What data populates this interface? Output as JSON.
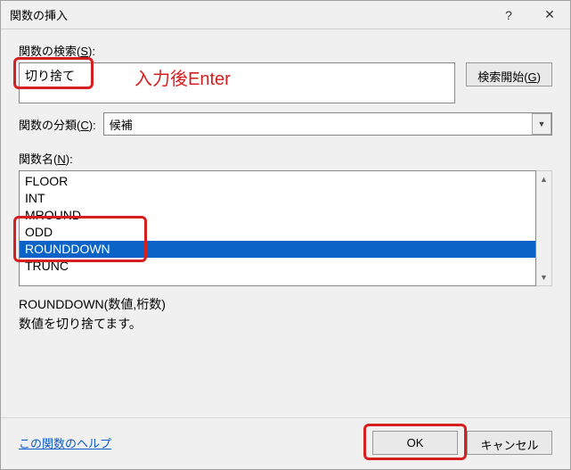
{
  "title": "関数の挿入",
  "labels": {
    "search": "関数の検索(",
    "search_u": "S",
    "search_end": "):",
    "category": "関数の分類(",
    "category_u": "C",
    "category_end": "):",
    "funcname": "関数名(",
    "funcname_u": "N",
    "funcname_end": "):"
  },
  "search_value": "切り捨て",
  "annotation": "入力後Enter",
  "search_button": "検索開始(",
  "search_button_u": "G",
  "search_button_end": ")",
  "category_value": "候補",
  "functions": [
    "FLOOR",
    "INT",
    "MROUND",
    "ODD",
    "ROUNDDOWN",
    "TRUNC"
  ],
  "selected_index": 4,
  "signature": "ROUNDDOWN(数値,桁数)",
  "description": "数値を切り捨てます。",
  "help_link": "この関数のヘルプ",
  "ok": "OK",
  "cancel": "キャンセル"
}
